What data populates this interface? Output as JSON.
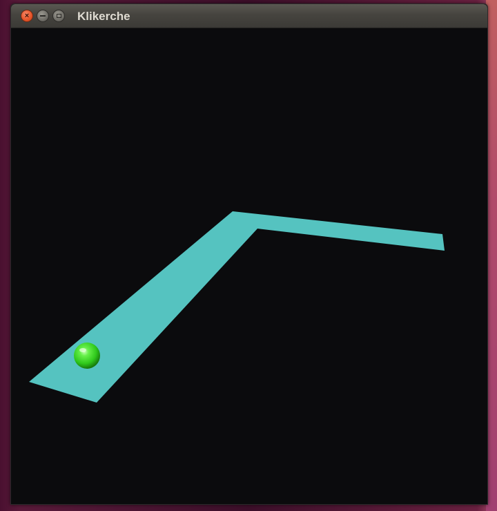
{
  "window": {
    "title": "Klikerche"
  },
  "scene": {
    "background_color": "#0b0b0d",
    "track_color": "#55c3c0",
    "ball_color": "#33dd22",
    "track_segments": 2,
    "objects": [
      "track",
      "ball"
    ]
  },
  "icons": {
    "close": "close-icon",
    "minimize": "minimize-icon",
    "maximize": "maximize-icon"
  }
}
